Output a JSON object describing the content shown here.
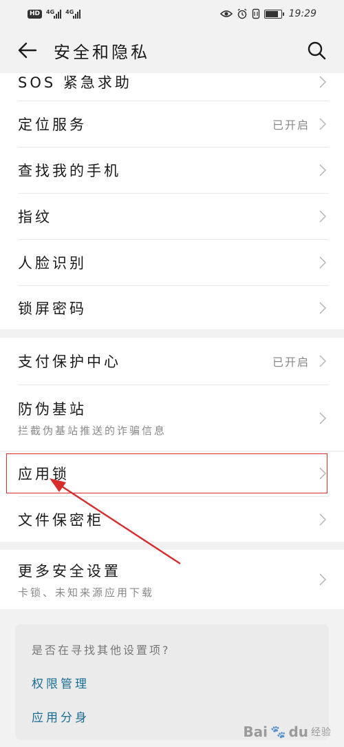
{
  "statusbar": {
    "hd_badge": "HD",
    "sig1_label": "4G",
    "sig2_label": "4G",
    "time": "19:29",
    "battery_level": 0.85
  },
  "header": {
    "title": "安全和隐私"
  },
  "rows": {
    "sos": {
      "label": "SOS 紧急求助"
    },
    "location": {
      "label": "定位服务",
      "value": "已开启"
    },
    "find_phone": {
      "label": "查找我的手机"
    },
    "fingerprint": {
      "label": "指纹"
    },
    "face": {
      "label": "人脸识别"
    },
    "lock_screen": {
      "label": "锁屏密码"
    },
    "payment": {
      "label": "支付保护中心",
      "value": "已开启"
    },
    "fake_station": {
      "label": "防伪基站",
      "sub": "拦截伪基站推送的诈骗信息"
    },
    "app_lock": {
      "label": "应用锁"
    },
    "file_safe": {
      "label": "文件保密柜"
    },
    "more_security": {
      "label": "更多安全设置",
      "sub": "卡锁、未知来源应用下载"
    }
  },
  "suggest": {
    "title": "是否在寻找其他设置项?",
    "link1": "权限管理",
    "link2": "应用分身"
  },
  "watermark": {
    "brand": "Bai",
    "brand2": "du",
    "jingyan": "经验"
  },
  "colors": {
    "accent_link": "#1a6e94",
    "highlight": "#d62c2c"
  }
}
